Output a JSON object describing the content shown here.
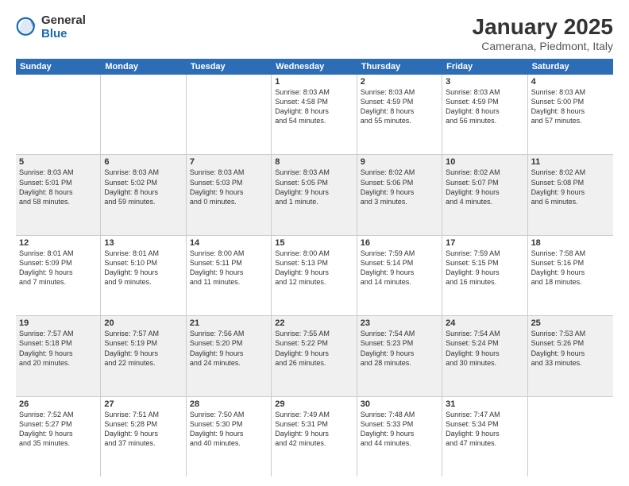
{
  "logo": {
    "general": "General",
    "blue": "Blue"
  },
  "title": "January 2025",
  "subtitle": "Camerana, Piedmont, Italy",
  "header_days": [
    "Sunday",
    "Monday",
    "Tuesday",
    "Wednesday",
    "Thursday",
    "Friday",
    "Saturday"
  ],
  "weeks": [
    [
      {
        "day": "",
        "info": ""
      },
      {
        "day": "",
        "info": ""
      },
      {
        "day": "",
        "info": ""
      },
      {
        "day": "1",
        "info": "Sunrise: 8:03 AM\nSunset: 4:58 PM\nDaylight: 8 hours\nand 54 minutes."
      },
      {
        "day": "2",
        "info": "Sunrise: 8:03 AM\nSunset: 4:59 PM\nDaylight: 8 hours\nand 55 minutes."
      },
      {
        "day": "3",
        "info": "Sunrise: 8:03 AM\nSunset: 4:59 PM\nDaylight: 8 hours\nand 56 minutes."
      },
      {
        "day": "4",
        "info": "Sunrise: 8:03 AM\nSunset: 5:00 PM\nDaylight: 8 hours\nand 57 minutes."
      }
    ],
    [
      {
        "day": "5",
        "info": "Sunrise: 8:03 AM\nSunset: 5:01 PM\nDaylight: 8 hours\nand 58 minutes."
      },
      {
        "day": "6",
        "info": "Sunrise: 8:03 AM\nSunset: 5:02 PM\nDaylight: 8 hours\nand 59 minutes."
      },
      {
        "day": "7",
        "info": "Sunrise: 8:03 AM\nSunset: 5:03 PM\nDaylight: 9 hours\nand 0 minutes."
      },
      {
        "day": "8",
        "info": "Sunrise: 8:03 AM\nSunset: 5:05 PM\nDaylight: 9 hours\nand 1 minute."
      },
      {
        "day": "9",
        "info": "Sunrise: 8:02 AM\nSunset: 5:06 PM\nDaylight: 9 hours\nand 3 minutes."
      },
      {
        "day": "10",
        "info": "Sunrise: 8:02 AM\nSunset: 5:07 PM\nDaylight: 9 hours\nand 4 minutes."
      },
      {
        "day": "11",
        "info": "Sunrise: 8:02 AM\nSunset: 5:08 PM\nDaylight: 9 hours\nand 6 minutes."
      }
    ],
    [
      {
        "day": "12",
        "info": "Sunrise: 8:01 AM\nSunset: 5:09 PM\nDaylight: 9 hours\nand 7 minutes."
      },
      {
        "day": "13",
        "info": "Sunrise: 8:01 AM\nSunset: 5:10 PM\nDaylight: 9 hours\nand 9 minutes."
      },
      {
        "day": "14",
        "info": "Sunrise: 8:00 AM\nSunset: 5:11 PM\nDaylight: 9 hours\nand 11 minutes."
      },
      {
        "day": "15",
        "info": "Sunrise: 8:00 AM\nSunset: 5:13 PM\nDaylight: 9 hours\nand 12 minutes."
      },
      {
        "day": "16",
        "info": "Sunrise: 7:59 AM\nSunset: 5:14 PM\nDaylight: 9 hours\nand 14 minutes."
      },
      {
        "day": "17",
        "info": "Sunrise: 7:59 AM\nSunset: 5:15 PM\nDaylight: 9 hours\nand 16 minutes."
      },
      {
        "day": "18",
        "info": "Sunrise: 7:58 AM\nSunset: 5:16 PM\nDaylight: 9 hours\nand 18 minutes."
      }
    ],
    [
      {
        "day": "19",
        "info": "Sunrise: 7:57 AM\nSunset: 5:18 PM\nDaylight: 9 hours\nand 20 minutes."
      },
      {
        "day": "20",
        "info": "Sunrise: 7:57 AM\nSunset: 5:19 PM\nDaylight: 9 hours\nand 22 minutes."
      },
      {
        "day": "21",
        "info": "Sunrise: 7:56 AM\nSunset: 5:20 PM\nDaylight: 9 hours\nand 24 minutes."
      },
      {
        "day": "22",
        "info": "Sunrise: 7:55 AM\nSunset: 5:22 PM\nDaylight: 9 hours\nand 26 minutes."
      },
      {
        "day": "23",
        "info": "Sunrise: 7:54 AM\nSunset: 5:23 PM\nDaylight: 9 hours\nand 28 minutes."
      },
      {
        "day": "24",
        "info": "Sunrise: 7:54 AM\nSunset: 5:24 PM\nDaylight: 9 hours\nand 30 minutes."
      },
      {
        "day": "25",
        "info": "Sunrise: 7:53 AM\nSunset: 5:26 PM\nDaylight: 9 hours\nand 33 minutes."
      }
    ],
    [
      {
        "day": "26",
        "info": "Sunrise: 7:52 AM\nSunset: 5:27 PM\nDaylight: 9 hours\nand 35 minutes."
      },
      {
        "day": "27",
        "info": "Sunrise: 7:51 AM\nSunset: 5:28 PM\nDaylight: 9 hours\nand 37 minutes."
      },
      {
        "day": "28",
        "info": "Sunrise: 7:50 AM\nSunset: 5:30 PM\nDaylight: 9 hours\nand 40 minutes."
      },
      {
        "day": "29",
        "info": "Sunrise: 7:49 AM\nSunset: 5:31 PM\nDaylight: 9 hours\nand 42 minutes."
      },
      {
        "day": "30",
        "info": "Sunrise: 7:48 AM\nSunset: 5:33 PM\nDaylight: 9 hours\nand 44 minutes."
      },
      {
        "day": "31",
        "info": "Sunrise: 7:47 AM\nSunset: 5:34 PM\nDaylight: 9 hours\nand 47 minutes."
      },
      {
        "day": "",
        "info": ""
      }
    ]
  ],
  "shaded_rows": [
    1,
    3
  ]
}
